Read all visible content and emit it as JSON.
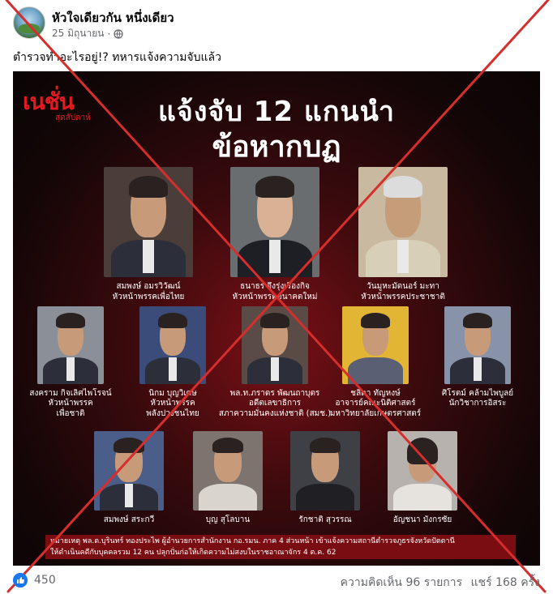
{
  "post": {
    "page_name": "หัวใจเดียวกัน หนึ่งเดียว",
    "date": "25 มิถุนายน",
    "separator": "·",
    "caption": "ตำรวจทำอะไรอยู่!? ทหารแจ้งความจับแล้ว"
  },
  "image": {
    "logo_main": "เนชั่น",
    "logo_sub": "สุดสัปดาห์",
    "headline_line1": "แจ้งจับ 12 แกนนำ",
    "headline_line2": "ข้อหากบฏ",
    "people": [
      {
        "name": "สมพงษ์ อมรวิวัฒน์",
        "role": "หัวหน้าพรรคเพื่อไทย"
      },
      {
        "name": "ธนาธร จึงรุ่งเรืองกิจ",
        "role": "หัวหน้าพรรคอนาคตใหม่"
      },
      {
        "name": "วันมูหะมัดนอร์ มะทา",
        "role": "หัวหน้าพรรคประชาชาติ"
      },
      {
        "name": "สงคราม กิจเลิศไพโรจน์",
        "role": "หัวหน้าพรรค\nเพื่อชาติ"
      },
      {
        "name": "นิกม บุญวิเศษ",
        "role": "หัวหน้าพรรค\nพลังปวงชนไทย"
      },
      {
        "name": "พล.ท.ภราดร พัฒนถาบุตร",
        "role": "อดีตเลขาธิการ\nสภาความมั่นคงแห่งชาติ (สมช.)"
      },
      {
        "name": "ชลิดา ทัญหงษ์",
        "role": "อาจารย์คณะนิติศาสตร์\nมหาวิทยาลัยเกษตรศาสตร์"
      },
      {
        "name": "ศิโรตม์ คล้ามไพบูลย์",
        "role": "นักวิชาการอิสระ"
      },
      {
        "name": "สมพงษ์ สระกวี",
        "role": ""
      },
      {
        "name": "บุญ สุโลบาน",
        "role": ""
      },
      {
        "name": "รักชาติ สุวรรณ",
        "role": ""
      },
      {
        "name": "อัญชนา มังกรซัย",
        "role": ""
      }
    ],
    "footnote_line1": "หมายเหตุ พล.ต.บุรินทร์ ทองประไพ ผู้อำนวยการสำนักงาน กอ.รมน. ภาค 4 ส่วนหน้า เข้าแจ้งความสถานีตำรวจภูธรจังหวัดปัตตานี",
    "footnote_line2": "ให้ดำเนินคดีกับบุคคลรวม 12 คน ปลุกปั่นก่อให้เกิดความไม่สงบในราชอาณาจักร 4 ต.ค. 62"
  },
  "footer": {
    "like_count": "450",
    "comments": "ความคิดเห็น 96 รายการ",
    "shares": "แชร์ 168 ครั้ง"
  },
  "colors": {
    "cross": "#d62d2d",
    "accent": "#e21a22",
    "like": "#1877f2"
  }
}
